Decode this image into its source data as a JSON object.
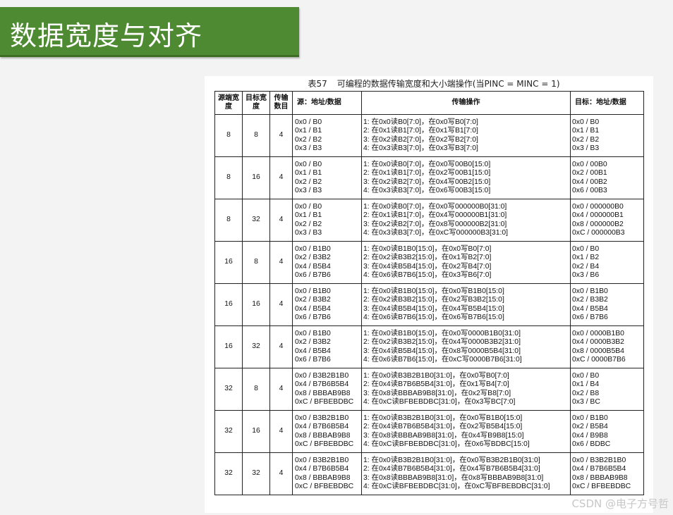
{
  "slide_title": "数据宽度与对齐",
  "table_caption": {
    "number": "表57",
    "text": "可编程的数据传输宽度和大小端操作(当PINC = MINC = 1)"
  },
  "headers": [
    "源端宽度",
    "目标宽度",
    "传输数目",
    "源：地址/数据",
    "传输操作",
    "目标：地址/数据"
  ],
  "rows": [
    {
      "src_width": "8",
      "dst_width": "8",
      "count": "4",
      "src": "0x0 / B0\n0x1 / B1\n0x2 / B2\n0x3 / B3",
      "ops": "1: 在0x0读B0[7:0]，在0x0写B0[7:0]\n2: 在0x1读B1[7:0]，在0x1写B1[7:0]\n3: 在0x2读B2[7:0]，在0x2写B2[7:0]\n4: 在0x3读B3[7:0]，在0x3写B3[7:0]",
      "dst": "0x0 / B0\n0x1 / B1\n0x2 / B2\n0x3 / B3"
    },
    {
      "src_width": "8",
      "dst_width": "16",
      "count": "4",
      "src": "0x0 / B0\n0x1 / B1\n0x2 / B2\n0x3 / B3",
      "ops": "1: 在0x0读B0[7:0]，在0x0写00B0[15:0]\n2: 在0x1读B1[7:0]，在0x2写00B1[15:0]\n3: 在0x2读B2[7:0]，在0x4写00B2[15:0]\n4: 在0x3读B3[7:0]，在0x6写00B3[15:0]",
      "dst": "0x0 / 00B0\n0x2 / 00B1\n0x4 / 00B2\n0x6 / 00B3"
    },
    {
      "src_width": "8",
      "dst_width": "32",
      "count": "4",
      "src": "0x0 / B0\n0x1 / B1\n0x2 / B2\n0x3 / B3",
      "ops": "1: 在0x0读B0[7:0]，在0x0写000000B0[31:0]\n2: 在0x1读B1[7:0]，在0x4写000000B1[31:0]\n3: 在0x2读B2[7:0]，在0x8写000000B2[31:0]\n4: 在0x3读B3[7:0]，在0xC写000000B3[31:0]",
      "dst": "0x0 / 000000B0\n0x4 / 000000B1\n0x8 / 000000B2\n0xC / 000000B3"
    },
    {
      "src_width": "16",
      "dst_width": "8",
      "count": "4",
      "src": "0x0 / B1B0\n0x2 / B3B2\n0x4 / B5B4\n0x6 / B7B6",
      "ops": "1: 在0x0读B1B0[15:0]，在0x0写B0[7:0]\n2: 在0x2读B3B2[15:0]，在0x1写B2[7:0]\n3: 在0x4读B5B4[15:0]，在0x2写B4[7:0]\n4: 在0x6读B7B6[15:0]，在0x3写B6[7:0]",
      "dst": "0x0 / B0\n0x1 / B2\n0x2 / B4\n0x3 / B6"
    },
    {
      "src_width": "16",
      "dst_width": "16",
      "count": "4",
      "src": "0x0 / B1B0\n0x2 / B3B2\n0x4 / B5B4\n0x6 / B7B6",
      "ops": "1: 在0x0读B1B0[15:0]，在0x0写B1B0[15:0]\n2: 在0x2读B3B2[15:0]，在0x2写B3B2[15:0]\n3: 在0x4读B5B4[15:0]，在0x4写B5B4[15:0]\n4: 在0x6读B7B6[15:0]，在0x6写B7B6[15:0]",
      "dst": "0x0 / B1B0\n0x2 / B3B2\n0x4 / B5B4\n0x6 / B7B6"
    },
    {
      "src_width": "16",
      "dst_width": "32",
      "count": "4",
      "src": "0x0 / B1B0\n0x2 / B3B2\n0x4 / B5B4\n0x6 / B7B6",
      "ops": "1: 在0x0读B1B0[15:0]，在0x0写0000B1B0[31:0]\n2: 在0x2读B3B2[15:0]，在0x4写0000B3B2[31:0]\n3: 在0x4读B5B4[15:0]，在0x8写0000B5B4[31:0]\n4: 在0x6读B7B6[15:0]，在0xC写0000B7B6[31:0]",
      "dst": "0x0 / 0000B1B0\n0x4 / 0000B3B2\n0x8 / 0000B5B4\n0xC / 0000B7B6"
    },
    {
      "src_width": "32",
      "dst_width": "8",
      "count": "4",
      "src": "0x0 / B3B2B1B0\n0x4 / B7B6B5B4\n0x8 / BBBAB9B8\n0xC / BFBEBDBC",
      "ops": "1: 在0x0读B3B2B1B0[31:0]，在0x0写B0[7:0]\n2: 在0x4读B7B6B5B4[31:0]，在0x1写B4[7:0]\n3: 在0x8读BBBAB9B8[31:0]，在0x2写B8[7:0]\n4: 在0xC读BFBEBDBC[31:0]，在0x3写BC[7:0]",
      "dst": "0x0 / B0\n0x1 / B4\n0x2 / B8\n0x3 / BC"
    },
    {
      "src_width": "32",
      "dst_width": "16",
      "count": "4",
      "src": "0x0 / B3B2B1B0\n0x4 / B7B6B5B4\n0x8 / BBBAB9B8\n0xC / BFBEBDBC",
      "ops": "1: 在0x0读B3B2B1B0[31:0]，在0x0写B1B0[15:0]\n2: 在0x4读B7B6B5B4[31:0]，在0x2写B5B4[15:0]\n3: 在0x8读BBBAB9B8[31:0]，在0x4写B9B8[15:0]\n4: 在0xC读BFBEBDBC[31:0]，在0x6写BDBC[15:0]",
      "dst": "0x0 / B1B0\n0x2 / B5B4\n0x4 / B9B8\n0x6 / BDBC"
    },
    {
      "src_width": "32",
      "dst_width": "32",
      "count": "4",
      "src": "0x0 / B3B2B1B0\n0x4 / B7B6B5B4\n0x8 / BBBAB9B8\n0xC / BFBEBDBC",
      "ops": "1: 在0x0读B3B2B1B0[31:0]，在0x0写B3B2B1B0[31:0]\n2: 在0x4读B7B6B5B4[31:0]，在0x4写B7B6B5B4[31:0]\n3: 在0x8读BBBAB9B8[31:0]，在0x8写BBBAB9B8[31:0]\n4: 在0xC读BFBEBDBC[31:0]，在0xC写BFBEBDBC[31:0]",
      "dst": "0x0 / B3B2B1B0\n0x4 / B7B6B5B4\n0x8 / BBBAB9B8\n0xC / BFBEBDBC"
    }
  ],
  "watermark": "CSDN @电子方号哲",
  "colors": {
    "title_banner": "#4e8a32",
    "background": "#f3f3f3"
  }
}
